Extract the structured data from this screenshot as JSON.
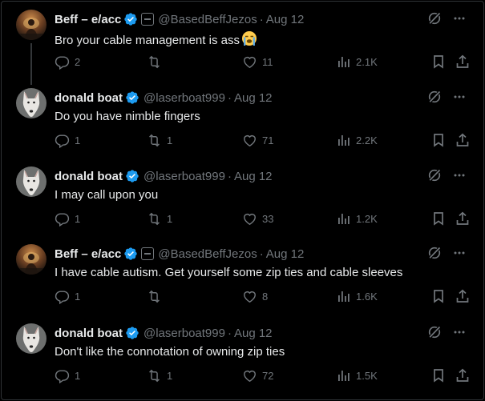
{
  "colors": {
    "background": "#000000",
    "text": "#e7e9ea",
    "muted": "#71767b",
    "verified": "#1d9bf0",
    "divider": "#2f3336"
  },
  "tweets": [
    {
      "name": "Beff – e/acc",
      "handle": "@BasedBeffJezos",
      "sep": "·",
      "date": "Aug 12",
      "text": "Bro your cable management is ass",
      "emoji": "loudly-crying-face",
      "replies": "2",
      "retweets": "",
      "likes": "11",
      "views": "2.1K",
      "avatar": "beff-avatar",
      "affiliation_badge": true
    },
    {
      "name": "donald boat",
      "handle": "@laserboat999",
      "sep": "·",
      "date": "Aug 12",
      "text": "Do you have nimble fingers",
      "replies": "1",
      "retweets": "1",
      "likes": "71",
      "views": "2.2K",
      "avatar": "dog-avatar",
      "affiliation_badge": false
    },
    {
      "name": "donald boat",
      "handle": "@laserboat999",
      "sep": "·",
      "date": "Aug 12",
      "text": "I may call upon you",
      "replies": "1",
      "retweets": "1",
      "likes": "33",
      "views": "1.2K",
      "avatar": "dog-avatar",
      "affiliation_badge": false
    },
    {
      "name": "Beff – e/acc",
      "handle": "@BasedBeffJezos",
      "sep": "·",
      "date": "Aug 12",
      "text": "I have cable autism. Get yourself some zip ties and cable sleeves",
      "replies": "1",
      "retweets": "",
      "likes": "8",
      "views": "1.6K",
      "avatar": "beff-avatar",
      "affiliation_badge": true
    },
    {
      "name": "donald boat",
      "handle": "@laserboat999",
      "sep": "·",
      "date": "Aug 12",
      "text": "Don't like the connotation of owning zip ties",
      "replies": "1",
      "retweets": "1",
      "likes": "72",
      "views": "1.5K",
      "avatar": "dog-avatar",
      "affiliation_badge": false
    }
  ]
}
